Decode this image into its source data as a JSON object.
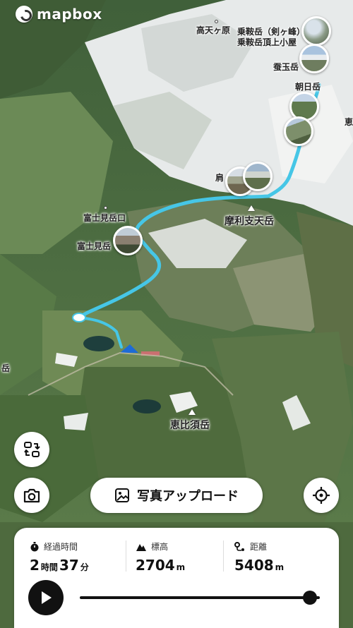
{
  "brand": {
    "name": "mapbox"
  },
  "map": {
    "labels": {
      "takamagahara": "高天ヶ原",
      "norikuradake": "乗鞍岳（剣ヶ峰）",
      "hut": "乗鞍岳頂上小屋",
      "kodamadake": "蚕玉岳",
      "asahidake": "朝日岳",
      "ebisu_partial": "恵",
      "kata_partial": "肩",
      "fujimidake_guchi": "富士見岳口",
      "fujimidake": "富士見岳",
      "marishiten": "摩利支天岳",
      "edge_left": "岳",
      "ebisudake": "恵比須岳"
    }
  },
  "controls": {
    "upload_label": "写真アップロード",
    "icons": {
      "reverse": "route-reverse-icon",
      "camera": "camera-icon",
      "locate": "crosshair-icon",
      "image": "image-icon",
      "play": "play-icon"
    }
  },
  "stats": {
    "elapsed": {
      "label": "経過時間",
      "hours": "2",
      "hours_unit": "時間",
      "minutes": "37",
      "minutes_unit": "分"
    },
    "elevation": {
      "label": "標高",
      "value": "2704",
      "unit": "m"
    },
    "distance": {
      "label": "距離",
      "value": "5408",
      "unit": "m"
    }
  },
  "playback": {
    "progress": 0.96
  },
  "colors": {
    "route": "#46c6e6",
    "accent": "#111111"
  }
}
